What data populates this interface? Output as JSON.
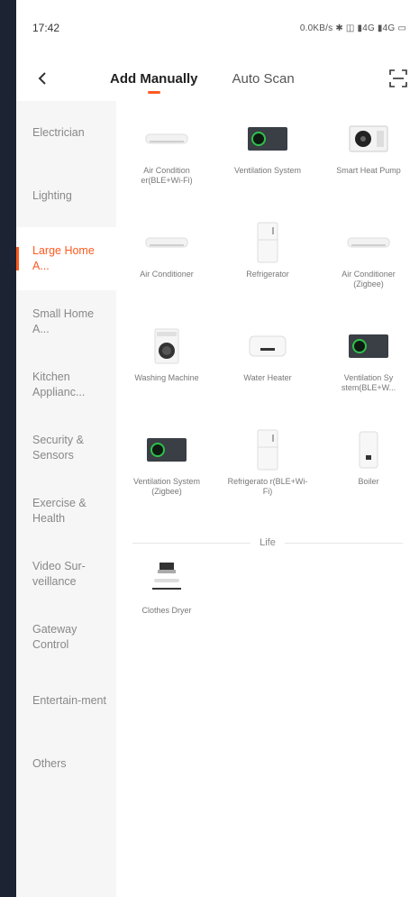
{
  "status": {
    "time": "17:42",
    "indicators": "0.0KB/s ✱ ◫ ▮4G ▮4G ▭"
  },
  "nav": {
    "back_icon": "chevron-left-icon",
    "scan_icon": "scan-icon"
  },
  "tabs": [
    {
      "label": "Add Manually",
      "active": true
    },
    {
      "label": "Auto Scan",
      "active": false
    }
  ],
  "sidebar": {
    "items": [
      {
        "label": "Electrician"
      },
      {
        "label": "Lighting"
      },
      {
        "label": "Large Home A...",
        "active": true
      },
      {
        "label": "Small Home A..."
      },
      {
        "label": "Kitchen Applianc..."
      },
      {
        "label": "Security & Sensors"
      },
      {
        "label": "Exercise & Health"
      },
      {
        "label": "Video Sur-veillance"
      },
      {
        "label": "Gateway Control"
      },
      {
        "label": "Entertain-ment"
      },
      {
        "label": "Others"
      }
    ]
  },
  "devices": [
    {
      "label": "Air Condition er(BLE+Wi-Fi)",
      "icon": "air-conditioner-icon"
    },
    {
      "label": "Ventilation System",
      "icon": "ventilation-icon"
    },
    {
      "label": "Smart Heat Pump",
      "icon": "heat-pump-icon"
    },
    {
      "label": "Air Conditioner",
      "icon": "air-conditioner-icon"
    },
    {
      "label": "Refrigerator",
      "icon": "refrigerator-icon"
    },
    {
      "label": "Air Conditioner (Zigbee)",
      "icon": "air-conditioner-icon"
    },
    {
      "label": "Washing Machine",
      "icon": "washing-machine-icon"
    },
    {
      "label": "Water Heater",
      "icon": "water-heater-icon"
    },
    {
      "label": "Ventilation Sy stem(BLE+W...",
      "icon": "ventilation-icon"
    },
    {
      "label": "Ventilation System (Zigbee)",
      "icon": "ventilation-icon"
    },
    {
      "label": "Refrigerato r(BLE+Wi-Fi)",
      "icon": "refrigerator-icon"
    },
    {
      "label": "Boiler",
      "icon": "boiler-icon"
    }
  ],
  "life_section": {
    "title": "Life",
    "devices": [
      {
        "label": "Clothes Dryer",
        "icon": "clothes-dryer-icon"
      }
    ]
  },
  "colors": {
    "accent": "#ff5a1f",
    "background": "#1c2333",
    "sidebar_bg": "#f6f6f6"
  }
}
